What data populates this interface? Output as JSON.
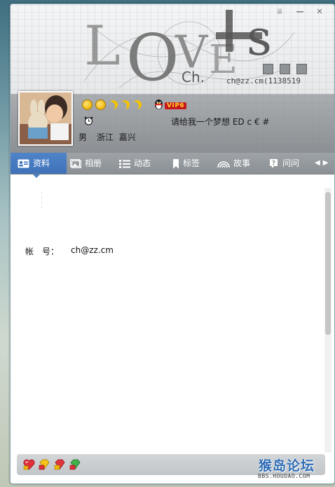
{
  "profile": {
    "nickname_art": "Ch.",
    "email_line": "ch@zz.cm(1138519",
    "vip_label": "VIP6",
    "signature": "请给我一个梦想 ED c € #",
    "gender": "男",
    "province": "浙江",
    "city": "嘉兴"
  },
  "tabs": [
    {
      "label": "资料",
      "icon": "id-card-icon",
      "active": true
    },
    {
      "label": "相册",
      "icon": "photo-album-icon",
      "active": false
    },
    {
      "label": "动态",
      "icon": "list-icon",
      "active": false
    },
    {
      "label": "标签",
      "icon": "bookmark-icon",
      "active": false
    },
    {
      "label": "故事",
      "icon": "rainbow-icon",
      "active": false
    },
    {
      "label": "问问",
      "icon": "question-icon",
      "active": false
    }
  ],
  "details": {
    "account_label": "帐　号：",
    "account_value": "ch@zz.cm"
  },
  "watermark": {
    "main": "猴岛论坛",
    "sub": "BBS.HOUDAO.COM"
  },
  "colors": {
    "tab_active": "#4a7fc4",
    "tab_bar": "#979ca0",
    "header_band": "#8c9094"
  }
}
